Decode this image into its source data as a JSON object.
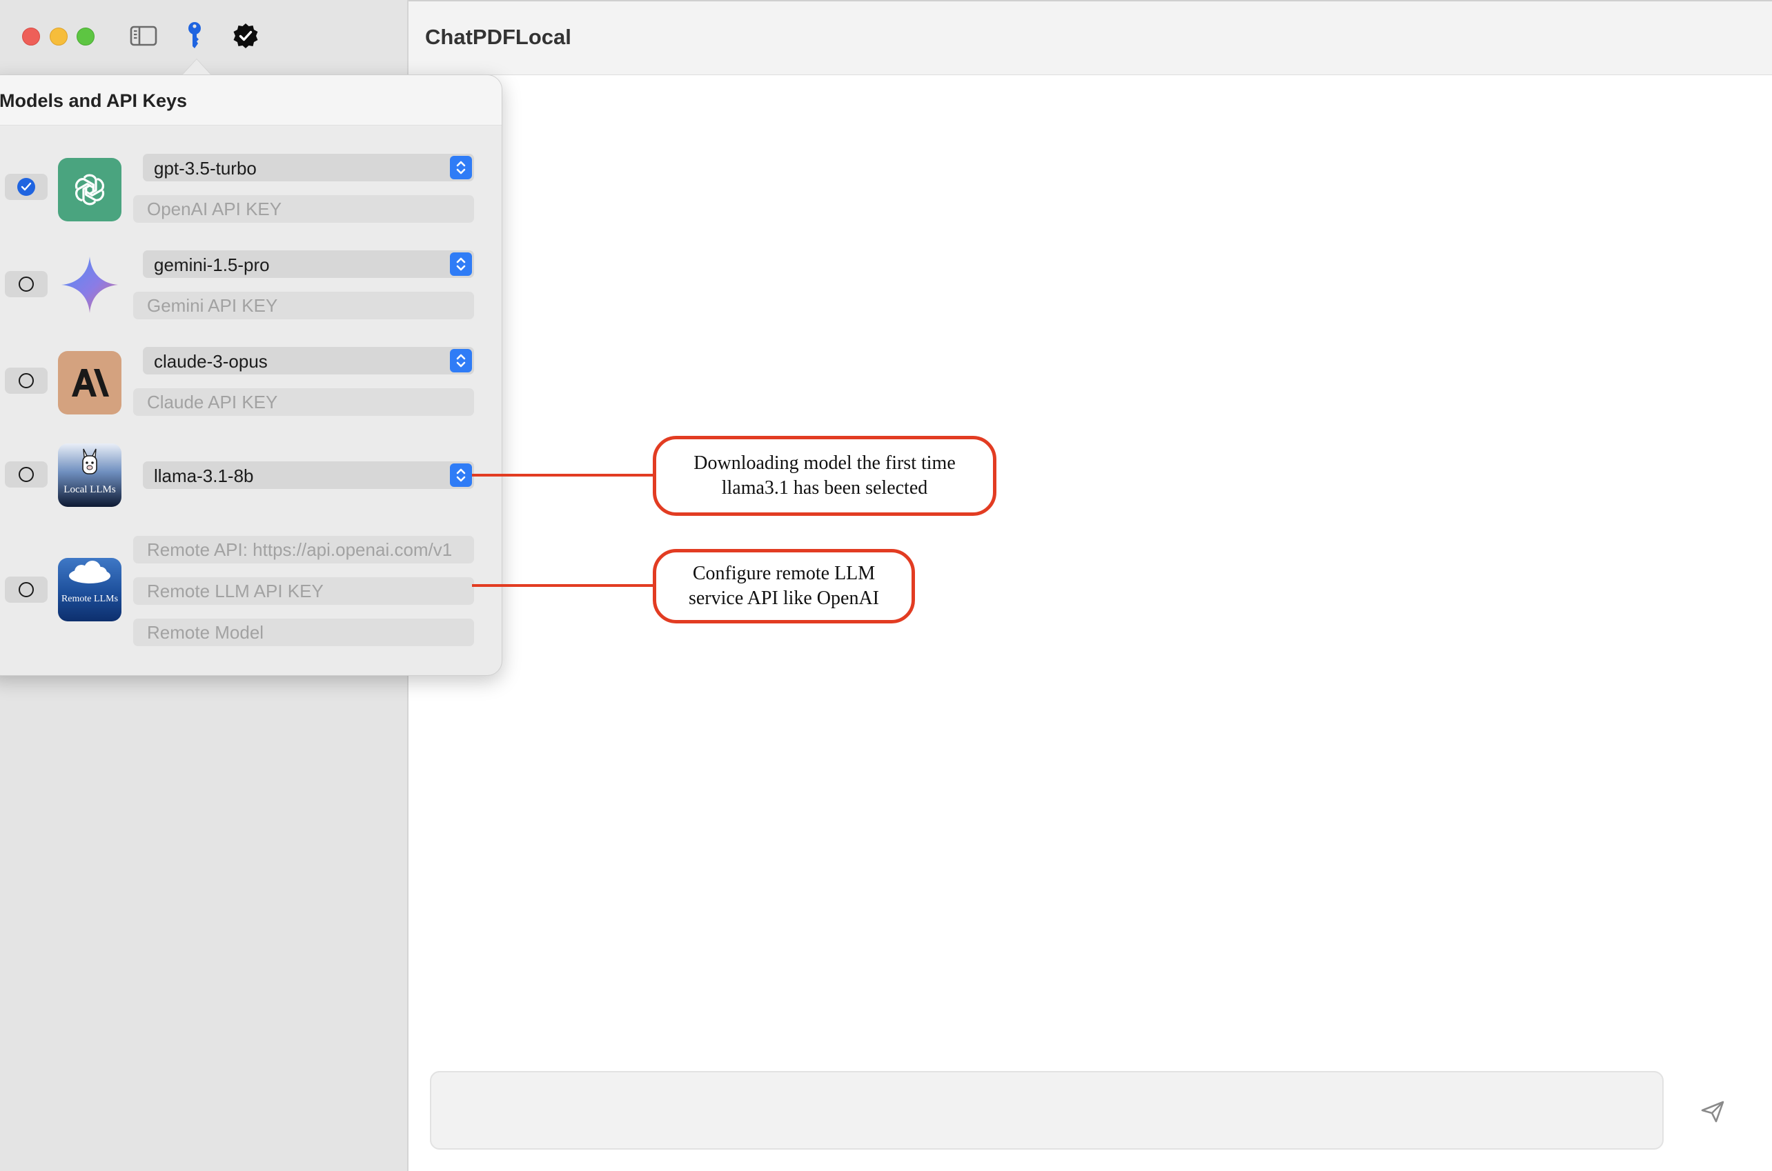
{
  "window": {
    "app_title": "ChatPDFLocal"
  },
  "toolbar": {
    "icons": [
      "sidebar-toggle-icon",
      "key-icon",
      "verified-badge-icon"
    ]
  },
  "popover": {
    "title": "Models and API Keys",
    "models": [
      {
        "selected": true,
        "logo": "openai-logo",
        "model": "gpt-3.5-turbo",
        "key_placeholder": "OpenAI API KEY"
      },
      {
        "selected": false,
        "logo": "gemini-logo",
        "model": "gemini-1.5-pro",
        "key_placeholder": "Gemini API KEY"
      },
      {
        "selected": false,
        "logo": "anthropic-logo",
        "model": "claude-3-opus",
        "key_placeholder": "Claude API KEY"
      },
      {
        "selected": false,
        "logo": "local-llms-logo",
        "logo_caption": "Local LLMs",
        "model": "llama-3.1-8b"
      },
      {
        "selected": false,
        "logo": "remote-llms-logo",
        "logo_caption": "Remote LLMs",
        "api_placeholder": "Remote API: https://api.openai.com/v1",
        "key_placeholder": "Remote LLM API KEY",
        "model_placeholder": "Remote Model"
      }
    ]
  },
  "callouts": {
    "local": {
      "line1": "Downloading model the first time",
      "line2": "llama3.1 has been selected"
    },
    "remote": {
      "line1": "Configure remote LLM",
      "line2": "service API like OpenAI"
    }
  },
  "colors": {
    "accent": "#2f7cf6",
    "callout": "#e23c22",
    "openai_green": "#4aa47f",
    "anthropic_tan": "#d4a27f"
  }
}
